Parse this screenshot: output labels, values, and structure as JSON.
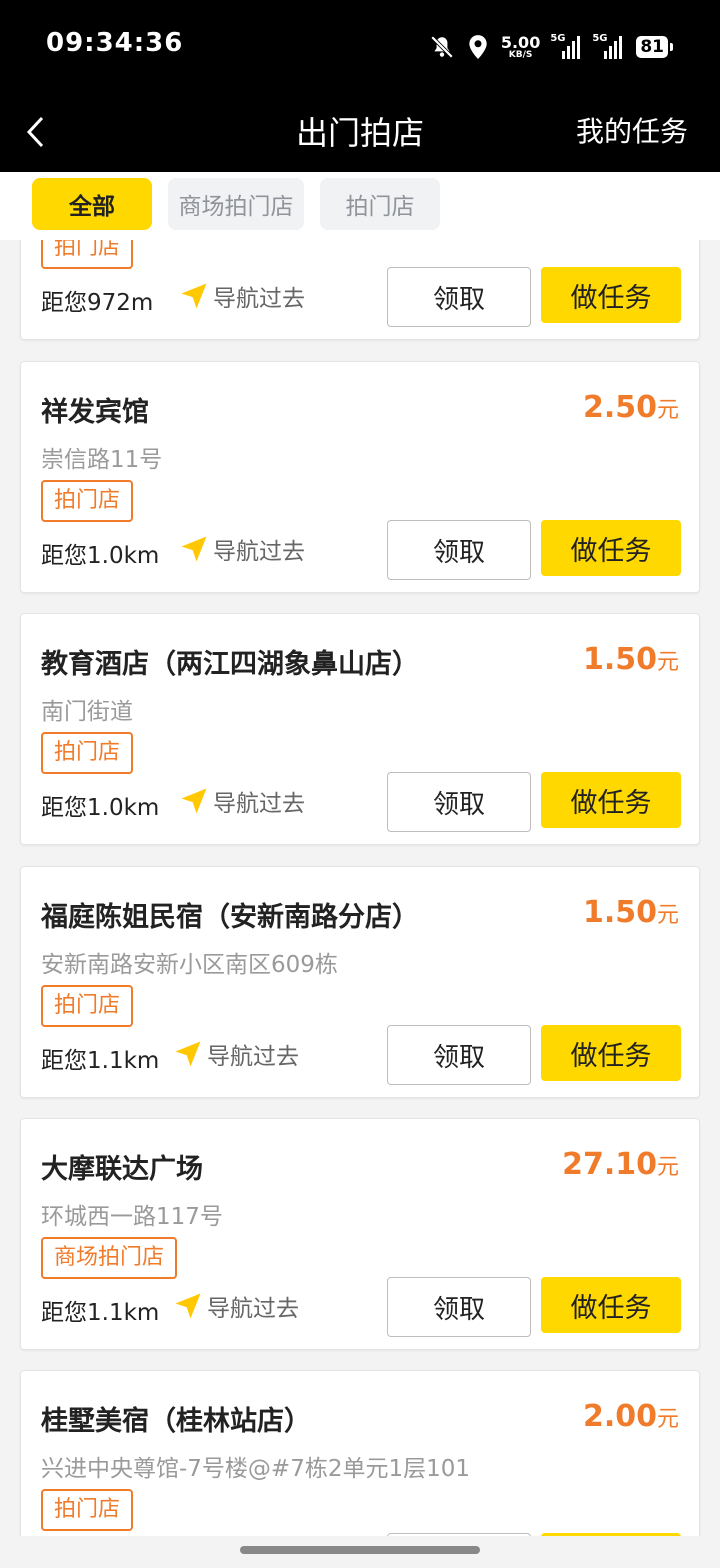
{
  "status_bar": {
    "time": "09:34:36",
    "net_speed_value": "5.00",
    "net_speed_unit": "KB/S",
    "signal1_label": "5G",
    "signal2_label": "5G",
    "battery": "81",
    "icons": [
      "bell-muted-icon",
      "location-pin-icon",
      "signal-icon",
      "signal-icon",
      "battery-icon"
    ]
  },
  "nav": {
    "title": "出门拍店",
    "right_label": "我的任务",
    "back_icon": "chevron-left-icon"
  },
  "filters": [
    {
      "label": "全部",
      "active": true
    },
    {
      "label": "商场拍门店",
      "active": false
    },
    {
      "label": "拍门店",
      "active": false
    }
  ],
  "colors": {
    "accent": "#ffd800",
    "price": "#f07c2b",
    "tag": "#f07c2b",
    "header": "#000000"
  },
  "list": {
    "partial_top": {
      "tag": "拍门店",
      "distance": "距您972m",
      "nav_label": "导航过去",
      "claim_label": "领取",
      "task_label": "做任务"
    },
    "items": [
      {
        "name": "祥发宾馆",
        "price": "2.50",
        "unit": "元",
        "address": "崇信路11号",
        "tag": "拍门店",
        "distance": "距您1.0km",
        "nav_label": "导航过去",
        "claim_label": "领取",
        "task_label": "做任务"
      },
      {
        "name": "教育酒店（两江四湖象鼻山店）",
        "price": "1.50",
        "unit": "元",
        "address": "南门街道",
        "tag": "拍门店",
        "distance": "距您1.0km",
        "nav_label": "导航过去",
        "claim_label": "领取",
        "task_label": "做任务"
      },
      {
        "name": "福庭陈姐民宿（安新南路分店）",
        "price": "1.50",
        "unit": "元",
        "address": "安新南路安新小区南区609栋",
        "tag": "拍门店",
        "distance": "距您1.1km",
        "nav_label": "导航过去",
        "claim_label": "领取",
        "task_label": "做任务"
      },
      {
        "name": "大摩联达广场",
        "price": "27.10",
        "unit": "元",
        "address": "环城西一路117号",
        "tag": "商场拍门店",
        "distance": "距您1.1km",
        "nav_label": "导航过去",
        "claim_label": "领取",
        "task_label": "做任务"
      },
      {
        "name": "桂墅美宿（桂林站店）",
        "price": "2.00",
        "unit": "元",
        "address": "兴进中央尊馆-7号楼@#7栋2单元1层101",
        "tag": "拍门店",
        "distance": "",
        "nav_label": "",
        "claim_label": "",
        "task_label": ""
      }
    ]
  }
}
